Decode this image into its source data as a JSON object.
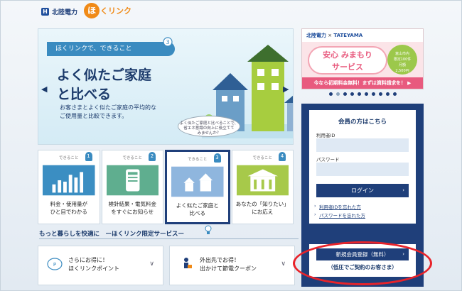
{
  "header": {
    "company_logo": "北陸電力",
    "service_logo_ho": "ほ",
    "service_logo_rest": "くリンク"
  },
  "banner": {
    "tagline": "ほくリンクで、できること",
    "bulb_number": "3",
    "title_line1": "よく似たご家庭",
    "title_line2": "と比べる",
    "desc_line1": "お客さまとよく似たご家庭の平均的な",
    "desc_line2": "ご使用量と比較できます。",
    "bubble_line1": "よく似たご家庭と比べることで、",
    "bubble_line2": "省エネ意識の向上に役立てて",
    "bubble_line3": "みませんか？",
    "prev_arrow": "◀",
    "next_arrow": "▶"
  },
  "tiles": [
    {
      "top": "できること",
      "num": "1",
      "line1": "料金・使用量が",
      "line2": "ひと目でわかる"
    },
    {
      "top": "できること",
      "num": "2",
      "line1": "検針結果・電気料金",
      "line2": "をすぐにお知らせ"
    },
    {
      "top": "できること",
      "num": "3",
      "line1": "よく似たご家庭と",
      "line2": "比べる"
    },
    {
      "top": "できること",
      "num": "4",
      "line1": "あなたの「知りたい」",
      "line2": "にお応え"
    }
  ],
  "section": {
    "title": "もっと暮らしを快適に　ーほくリンク限定サービスー"
  },
  "services": [
    {
      "line1": "さらにお得に！",
      "line2": "ほくリンクポイント",
      "chev": "∨"
    },
    {
      "line1": "外出先でお得！",
      "line2": "出かけて節電クーポン",
      "chev": "∨"
    }
  ],
  "ad": {
    "partner_left": "北陸電力",
    "partner_sep": "×",
    "partner_right": "TATEYAMA",
    "main_line1": "安心 みまもり",
    "main_line2": "サービス",
    "badge_line1": "富山市内",
    "badge_line2": "限定100件",
    "badge_line3": "月額",
    "badge_line4": "2,500円",
    "footer": "今なら初期料金無料！まずは資料請求を！ ▶"
  },
  "login": {
    "title": "会員の方はこちら",
    "user_id_label": "利用者ID",
    "password_label": "パスワード",
    "login_button": "ログイン",
    "forgot_id": "利用者IDを忘れた方",
    "forgot_password": "パスワードを忘れた方",
    "register_button": "新規会員登録（無料）",
    "register_sub": "（低圧でご契約のお客さま）",
    "chev": "›"
  },
  "colors": {
    "navy": "#1f3f7a",
    "accent_blue": "#3a8bc0",
    "highlight_red": "#e8232a",
    "pink": "#e85a7e"
  }
}
